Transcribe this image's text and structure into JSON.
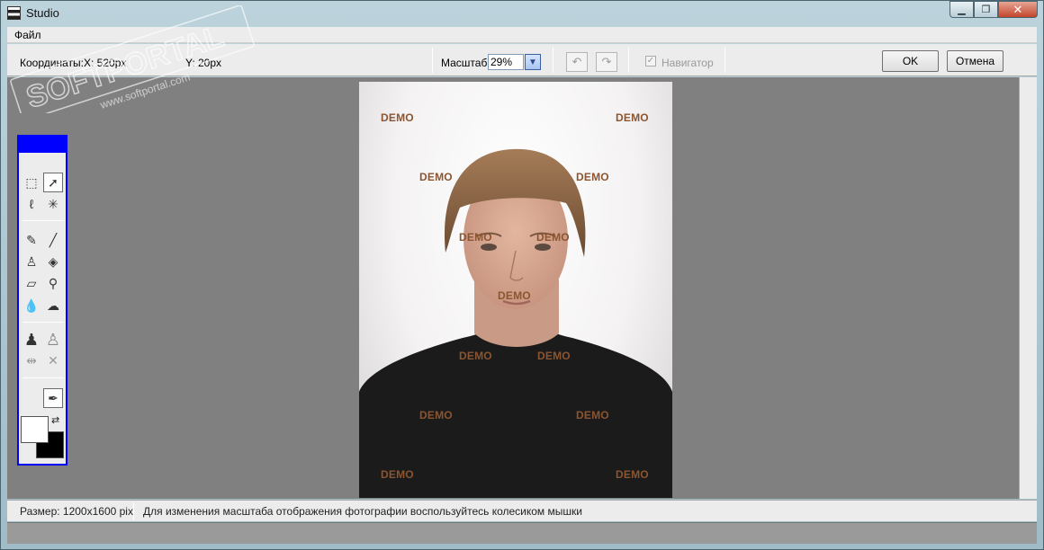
{
  "window": {
    "title": "Studio"
  },
  "menu": {
    "file": "Файл"
  },
  "toolbar": {
    "coords_label": "Координаты:",
    "x_value": "X: 520px",
    "y_value": "Y: 20px",
    "zoom_label": "Масштаб:",
    "zoom_value": "29%",
    "navigator_label": "Навигатор",
    "ok_label": "OK",
    "cancel_label": "Отмена"
  },
  "photo": {
    "watermarks": [
      "DEMO",
      "DEMO",
      "DEMO",
      "DEMO",
      "DEMO",
      "DEMO",
      "DEMO",
      "DEMO",
      "DEMO",
      "DEMO",
      "DEMO",
      "DEMO",
      "DEMO"
    ]
  },
  "status": {
    "size": "Размер: 1200x1600 pix",
    "hint": "Для изменения масштаба отображения фотографии воспользуйтесь колесиком мышки"
  },
  "watermark": {
    "brand": "SOFTPORTAL",
    "url": "www.softportal.com"
  },
  "colors": {
    "foreground": "#ffffff",
    "background": "#000000",
    "palette_border": "#0000ff"
  }
}
